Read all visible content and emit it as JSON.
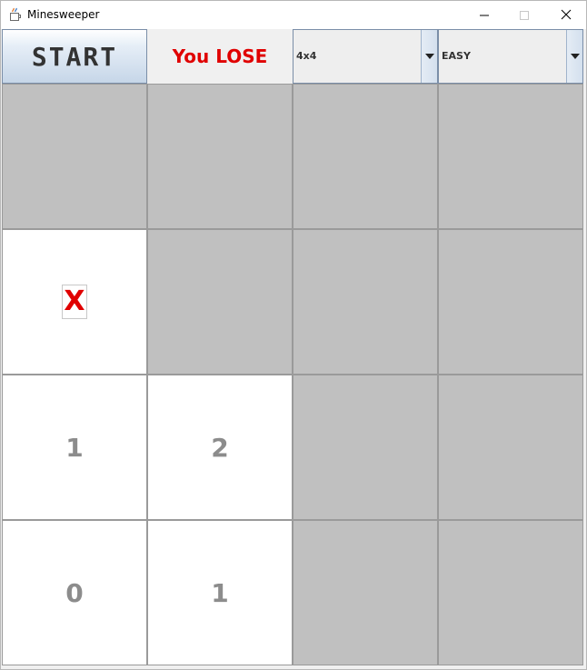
{
  "window": {
    "title": "Minesweeper"
  },
  "toolbar": {
    "start_label": "START",
    "status_text": "You LOSE",
    "size_select": {
      "selected": "4x4"
    },
    "difficulty_select": {
      "selected": "EASY"
    }
  },
  "colors": {
    "covered_cell": "#c0c0c0",
    "revealed_cell": "#ffffff",
    "number_text": "#8c8c8c",
    "mine_and_status": "#e00000"
  },
  "board": {
    "rows": 4,
    "cols": 4,
    "cells": [
      [
        {
          "state": "covered",
          "text": ""
        },
        {
          "state": "covered",
          "text": ""
        },
        {
          "state": "covered",
          "text": ""
        },
        {
          "state": "covered",
          "text": ""
        }
      ],
      [
        {
          "state": "mine",
          "text": "X"
        },
        {
          "state": "covered",
          "text": ""
        },
        {
          "state": "covered",
          "text": ""
        },
        {
          "state": "covered",
          "text": ""
        }
      ],
      [
        {
          "state": "revealed",
          "text": "1"
        },
        {
          "state": "revealed",
          "text": "2"
        },
        {
          "state": "covered",
          "text": ""
        },
        {
          "state": "covered",
          "text": ""
        }
      ],
      [
        {
          "state": "revealed",
          "text": "0"
        },
        {
          "state": "revealed",
          "text": "1"
        },
        {
          "state": "covered",
          "text": ""
        },
        {
          "state": "covered",
          "text": ""
        }
      ]
    ]
  },
  "icons": {
    "app": "java-coffee-icon",
    "minimize": "minimize-icon",
    "maximize": "maximize-icon",
    "close": "close-icon",
    "dropdown": "chevron-down-icon"
  }
}
